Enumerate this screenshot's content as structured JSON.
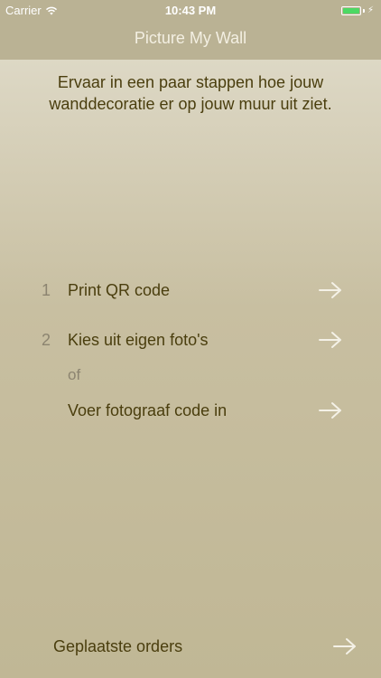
{
  "status_bar": {
    "carrier": "Carrier",
    "time": "10:43 PM"
  },
  "nav": {
    "title": "Picture My Wall"
  },
  "intro": {
    "text": "Ervaar in een paar stappen hoe jouw wanddecoratie er op jouw muur uit ziet."
  },
  "steps": [
    {
      "number": "1",
      "label": "Print QR code"
    },
    {
      "number": "2",
      "label": "Kies uit eigen foto's"
    }
  ],
  "or_text": "of",
  "photographer_code": {
    "label": "Voer fotograaf code in"
  },
  "orders": {
    "label": "Geplaatste orders"
  },
  "colors": {
    "header": "#bab294",
    "text_dark": "#4a3e0e",
    "text_muted": "#8c8470",
    "arrow": "#f4f1e7",
    "battery": "#4cd964"
  },
  "icons": [
    "wifi-icon",
    "battery-icon",
    "arrow-right-icon"
  ]
}
